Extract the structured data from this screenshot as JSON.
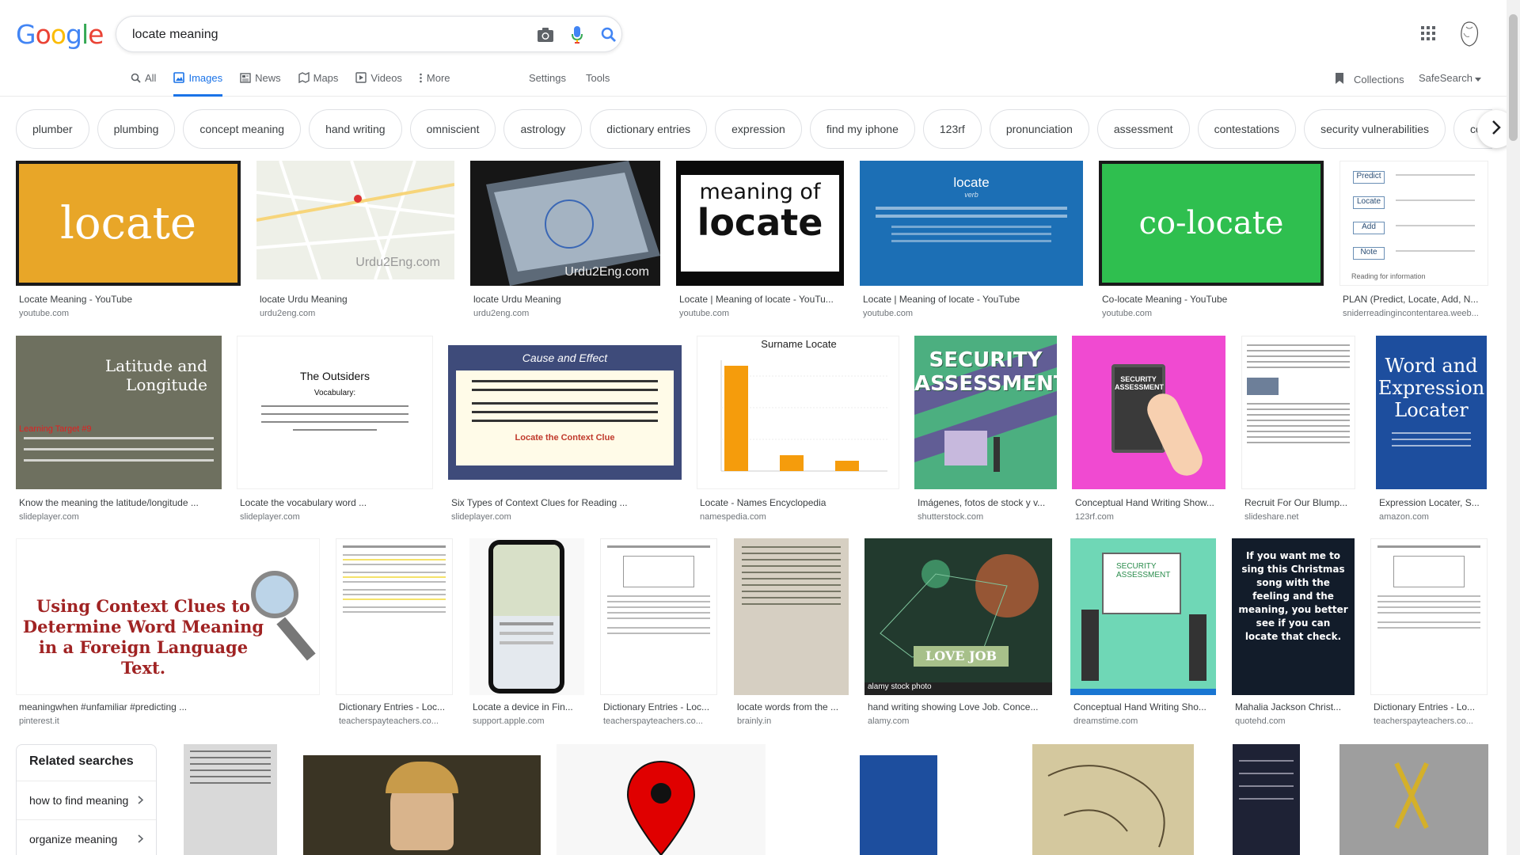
{
  "logo": {
    "letters": [
      "G",
      "o",
      "o",
      "g",
      "l",
      "e"
    ],
    "colors": [
      "#4285f4",
      "#ea4335",
      "#fbbc05",
      "#4285f4",
      "#34a853",
      "#ea4335"
    ]
  },
  "search": {
    "value": "locate meaning"
  },
  "icons": {
    "camera": "camera-icon",
    "mic": "mic-icon",
    "search": "search-icon",
    "apps": "apps-grid-icon",
    "avatar": "avatar-icon"
  },
  "nav": {
    "tabs": [
      {
        "label": "All",
        "icon": "search-icon"
      },
      {
        "label": "Images",
        "icon": "image-icon",
        "active": true
      },
      {
        "label": "News",
        "icon": "news-icon"
      },
      {
        "label": "Maps",
        "icon": "map-icon"
      },
      {
        "label": "Videos",
        "icon": "video-icon"
      },
      {
        "label": "More",
        "icon": "more-vert-icon"
      }
    ],
    "settings": "Settings",
    "tools": "Tools",
    "collections": "Collections",
    "safesearch": "SafeSearch"
  },
  "chips": [
    "plumber",
    "plumbing",
    "concept meaning",
    "hand writing",
    "omniscient",
    "astrology",
    "dictionary entries",
    "expression",
    "find my iphone",
    "123rf",
    "pronunciation",
    "assessment",
    "contestations",
    "security vulnerabilities",
    "conte"
  ],
  "rows": [
    [
      {
        "title": "Locate Meaning - YouTube",
        "source": "youtube.com",
        "thumb_text": "locate"
      },
      {
        "title": "locate Urdu Meaning",
        "source": "urdu2eng.com",
        "thumb_text": "Urdu2Eng.com"
      },
      {
        "title": "locate Urdu Meaning",
        "source": "urdu2eng.com",
        "thumb_text": "Urdu2Eng.com"
      },
      {
        "title": "Locate | Meaning of locate - YouTu...",
        "source": "youtube.com",
        "thumb_text": "meaning of",
        "thumb_text2": "locate"
      },
      {
        "title": "Locate | Meaning of locate - YouTube",
        "source": "youtube.com",
        "thumb_text": "locate",
        "thumb_text2": "verb"
      },
      {
        "title": "Co-locate Meaning - YouTube",
        "source": "youtube.com",
        "thumb_text": "co-locate"
      },
      {
        "title": "PLAN (Predict, Locate, Add, N...",
        "source": "sniderreadingincontentarea.weeb...",
        "thumb_items": [
          "Predict",
          "Locate",
          "Add",
          "Note"
        ],
        "thumb_caption": "Reading for information"
      }
    ],
    [
      {
        "title": "Know the meaning the latitude/longitude ...",
        "source": "slideplayer.com",
        "thumb_text": "Latitude and Longitude",
        "thumb_text2": "Learning Target #9"
      },
      {
        "title": "Locate the vocabulary word ...",
        "source": "slideplayer.com",
        "thumb_text": "The Outsiders",
        "thumb_text2": "Vocabulary:"
      },
      {
        "title": "Six Types of Context Clues for Reading ...",
        "source": "slideplayer.com",
        "thumb_text": "Cause and Effect",
        "thumb_text2": "Locate the Context Clue"
      },
      {
        "title": "Locate - Names Encyclopedia",
        "source": "namespedia.com",
        "thumb_text": "Surname Locate"
      },
      {
        "title": "Imágenes, fotos de stock y v...",
        "source": "shutterstock.com",
        "thumb_text": "SECURITY ASSESSMENT!"
      },
      {
        "title": "Conceptual Hand Writing Show...",
        "source": "123rf.com",
        "thumb_text": "SECURITY ASSESSMENT"
      },
      {
        "title": "Recruit For Our Blump...",
        "source": "slideshare.net"
      },
      {
        "title": "Expression Locater, S...",
        "source": "amazon.com",
        "thumb_text": "Word and Expression Locater"
      }
    ],
    [
      {
        "title": "meaningwhen #unfamiliar #predicting ...",
        "source": "pinterest.it",
        "thumb_text": "Using Context Clues to Determine Word Meaning in a Foreign Language Text."
      },
      {
        "title": "Dictionary Entries - Loc...",
        "source": "teacherspayteachers.co..."
      },
      {
        "title": "Locate a device in Fin...",
        "source": "support.apple.com"
      },
      {
        "title": "Dictionary Entries - Loc...",
        "source": "teacherspayteachers.co..."
      },
      {
        "title": "locate words from the ...",
        "source": "brainly.in"
      },
      {
        "title": "hand writing showing Love Job. Conce...",
        "source": "alamy.com",
        "thumb_text": "LOVE JOB",
        "thumb_text2": "alamy stock photo"
      },
      {
        "title": "Conceptual Hand Writing Sho...",
        "source": "dreamstime.com",
        "thumb_text": "SECURITY ASSESSMENT"
      },
      {
        "title": "Mahalia Jackson Christ...",
        "source": "quotehd.com",
        "thumb_text": "If you want me to sing this Christmas song with the feeling and the meaning, you better see if you can locate that check."
      },
      {
        "title": "Dictionary Entries - Lo...",
        "source": "teacherspayteachers.co..."
      }
    ]
  ],
  "related": {
    "title": "Related searches",
    "items": [
      "how to find meaning",
      "organize meaning"
    ]
  },
  "bottom_thumbs": [
    "text-page",
    "woman-portrait",
    "map-pin",
    "word-expression-locater-book",
    "anatomy-sketch",
    "asteroids-astrology",
    "zodiac-symbols"
  ]
}
